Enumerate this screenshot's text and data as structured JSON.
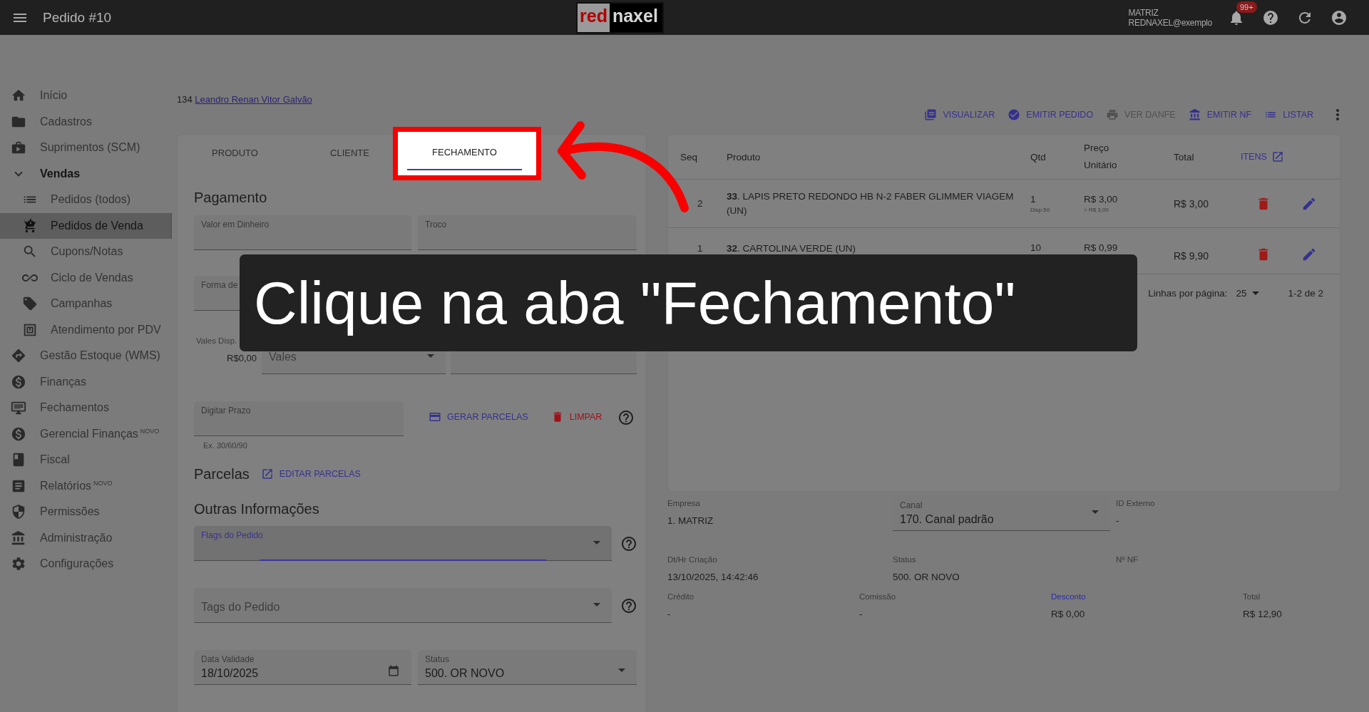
{
  "header": {
    "title": "Pedido #10",
    "logo": {
      "part_1": "red",
      "part_2": "naxel"
    },
    "user": {
      "company": "MATRIZ",
      "email": "REDNAXEL@exemplo"
    },
    "notifications": "99+"
  },
  "sidebar": {
    "items": [
      {
        "label": "Início",
        "selected": false
      },
      {
        "label": "Cadastros",
        "selected": false
      },
      {
        "label": "Suprimentos (SCM)",
        "selected": false
      },
      {
        "label": "Vendas",
        "selected": false,
        "expanded": true,
        "children": [
          {
            "label": "Pedidos (todos)",
            "selected": false
          },
          {
            "label": "Pedidos de Venda",
            "selected": true
          },
          {
            "label": "Cupons/Notas",
            "selected": false
          },
          {
            "label": "Ciclo de Vendas",
            "selected": false
          },
          {
            "label": "Campanhas",
            "selected": false
          },
          {
            "label": "Atendimento por PDV",
            "selected": false
          }
        ]
      },
      {
        "label": "Gestão Estoque (WMS)",
        "selected": false
      },
      {
        "label": "Finanças",
        "selected": false
      },
      {
        "label": "Fechamentos",
        "selected": false
      },
      {
        "label": "Gerencial Finanças",
        "badge": "NOVO",
        "selected": false
      },
      {
        "label": "Fiscal",
        "selected": false
      },
      {
        "label": "Relatórios",
        "badge": "NOVO",
        "selected": false
      },
      {
        "label": "Permissões",
        "selected": false
      },
      {
        "label": "Administração",
        "selected": false
      },
      {
        "label": "Configurações",
        "selected": false
      }
    ]
  },
  "customer": {
    "code": "134",
    "name": "Leandro Renan Vitor Galvão"
  },
  "actions": [
    {
      "label": "VISUALIZAR",
      "disabled": false
    },
    {
      "label": "EMITIR PEDIDO",
      "disabled": false
    },
    {
      "label": "VER DANFE",
      "disabled": true
    },
    {
      "label": "EMITIR NF",
      "disabled": false
    },
    {
      "label": "LISTAR",
      "disabled": false
    }
  ],
  "tabs": [
    {
      "label": "PRODUTO",
      "selected": false
    },
    {
      "label": "CLIENTE",
      "selected": false
    },
    {
      "label": "FECHAMENTO",
      "selected": true
    }
  ],
  "form": {
    "payment_title": "Pagamento",
    "cash_field": "Valor em Dinheiro",
    "change_field": "Troco",
    "payment_method_field": "Forma de",
    "vouchers_label": "Vales Disp.",
    "vouchers_value": "R$0,00",
    "vouchers_select": "Vales",
    "term_field": "Digitar Prazo",
    "term_hint": "Ex. 30/60/90",
    "generate_button": "GERAR PARCELAS",
    "clear_button": "LIMPAR",
    "installments_title": "Parcelas",
    "edit_installments": "EDITAR PARCELAS",
    "other_title": "Outras Informações",
    "flags_field": "Flags do Pedido",
    "tags_field": "Tags do Pedido",
    "validity": {
      "label": "Data Validade",
      "value": "18/10/2025"
    },
    "status": {
      "label": "Status",
      "value": "500. OR NOVO"
    }
  },
  "table": {
    "columns": [
      "Seq",
      "Produto",
      "Qtd",
      "Preço Unitário",
      "Total"
    ],
    "items_link": "ITENS",
    "rows": [
      {
        "seq": "2",
        "product": "**33**. LAPIS PRETO REDONDO HB N-2 FABER GLIMMER VIAGEM (UN)",
        "qty": "1",
        "stock": "Disp:50",
        "price": "R$ 3,00",
        "price_note": "= R$ 3,00",
        "total": "R$ 3,00"
      },
      {
        "seq": "1",
        "product": "**32**. CARTOLINA VERDE (UN)",
        "qty": "10",
        "price": "R$ 0,99",
        "total": "R$ 9,90"
      }
    ],
    "pagination": {
      "label": "Linhas por página:",
      "per_page": "25",
      "range": "1-2 de 2"
    }
  },
  "summary": {
    "company": {
      "label": "Empresa",
      "value": "1. MATRIZ"
    },
    "channel": {
      "label": "Canal",
      "value": "170. Canal padrão"
    },
    "external_id": {
      "label": "ID Externo",
      "value": "-"
    },
    "created": {
      "label": "Dt/Hr Criação",
      "value": "13/10/2025, 14:42:46"
    },
    "status": {
      "label": "Status",
      "value": "500. OR NOVO"
    },
    "invoice_no": {
      "label": "Nº NF"
    },
    "credit": {
      "label": "Crédito",
      "value": "-"
    },
    "commission": {
      "label": "Comissão",
      "value": "-"
    },
    "discount": {
      "label": "Desconto",
      "value": "R$ 0,00"
    },
    "total": {
      "label": "Total",
      "value": "R$ 12,90"
    }
  },
  "caption": "Clique na aba \"Fechamento\""
}
